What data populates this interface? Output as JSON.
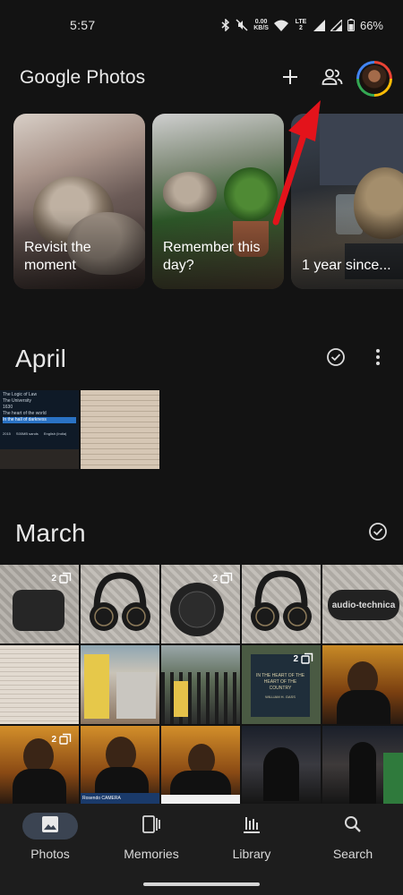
{
  "status_bar": {
    "time": "5:57",
    "net_speed": "0.00",
    "net_unit": "KB/S",
    "lte": "LTE 2",
    "battery": "66%"
  },
  "header": {
    "title": "Google Photos",
    "add_icon": "plus-icon",
    "share_icon": "people-icon"
  },
  "memories": [
    {
      "caption": "Revisit the moment"
    },
    {
      "caption": "Remember this day?"
    },
    {
      "caption": "1 year since..."
    }
  ],
  "sections": {
    "april": {
      "title": "April",
      "tile_texts": {
        "menu_lines": [
          "The Logic of Law",
          "The University",
          "1630",
          "The heart of the world",
          "In the hall of darkness"
        ],
        "footer": [
          "2015",
          "S00MB sands",
          "English (India)"
        ]
      }
    },
    "march": {
      "title": "March",
      "badge_count": "2",
      "brand_text": "audio-technica",
      "book_cover": "IN THE HEART OF THE HEART OF THE COUNTRY",
      "book_author": "WILLIAM H. GASS",
      "news_ticker": "Rosendo CAMERA"
    }
  },
  "bottom_nav": [
    {
      "label": "Photos",
      "icon": "photo-icon",
      "active": true
    },
    {
      "label": "Memories",
      "icon": "memories-icon",
      "active": false
    },
    {
      "label": "Library",
      "icon": "library-icon",
      "active": false
    },
    {
      "label": "Search",
      "icon": "search-icon",
      "active": false
    }
  ],
  "colors": {
    "background": "#131313",
    "nav_background": "#1d1d1d",
    "active_pill": "#3b4452",
    "annotation_arrow": "#e3131b"
  }
}
